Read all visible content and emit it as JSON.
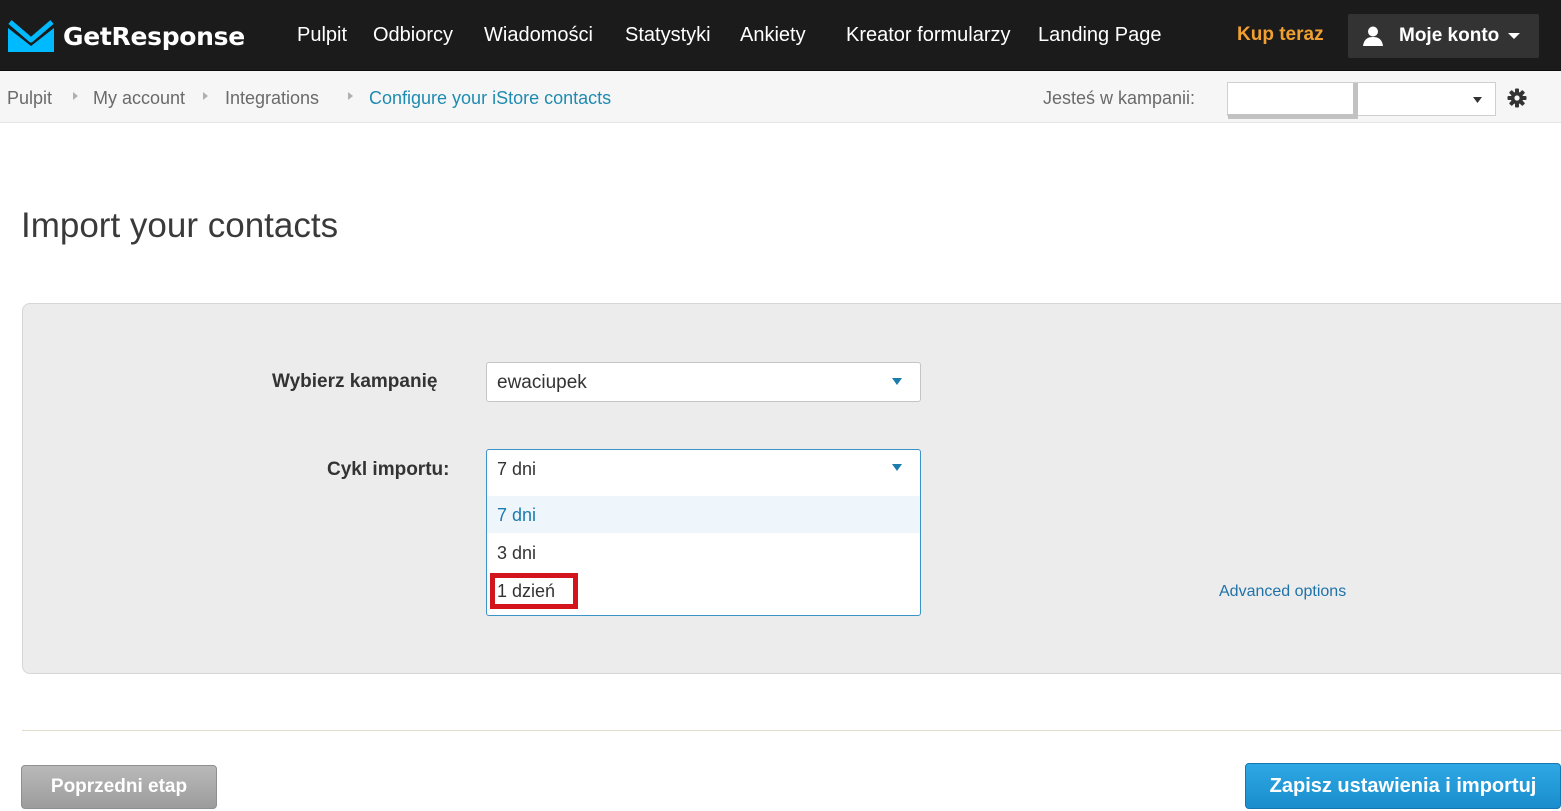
{
  "brand": {
    "name": "GetResponse",
    "logo_icon": "envelope-logo-icon",
    "accent_color": "#00baff"
  },
  "nav": {
    "items": [
      {
        "label": "Pulpit"
      },
      {
        "label": "Odbiorcy"
      },
      {
        "label": "Wiadomości"
      },
      {
        "label": "Statystyki"
      },
      {
        "label": "Ankiety"
      },
      {
        "label": "Kreator formularzy"
      },
      {
        "label": "Landing Page"
      }
    ],
    "buy_label": "Kup teraz",
    "buy_color": "#f0a030",
    "account_label": "Moje konto",
    "account_icon": "user-icon"
  },
  "breadcrumb": {
    "items": [
      {
        "label": "Pulpit"
      },
      {
        "label": "My account"
      },
      {
        "label": "Integrations"
      },
      {
        "label": "Configure your iStore contacts"
      }
    ],
    "campaign_label": "Jesteś w kampanii:",
    "campaign_value": "",
    "settings_icon": "gear-icon"
  },
  "page": {
    "title": "Import your contacts"
  },
  "form": {
    "campaign_label": "Wybierz kampanię",
    "campaign_value": "ewaciupek",
    "cycle_label": "Cykl importu:",
    "cycle_value": "7 dni",
    "cycle_options": [
      {
        "label": "7 dni",
        "selected": true
      },
      {
        "label": "3 dni",
        "selected": false
      },
      {
        "label": "1 dzień",
        "selected": false,
        "highlighted": true
      }
    ],
    "advanced_link": "Advanced options"
  },
  "actions": {
    "prev_label": "Poprzedni etap",
    "save_label": "Zapisz ustawienia i importuj"
  }
}
